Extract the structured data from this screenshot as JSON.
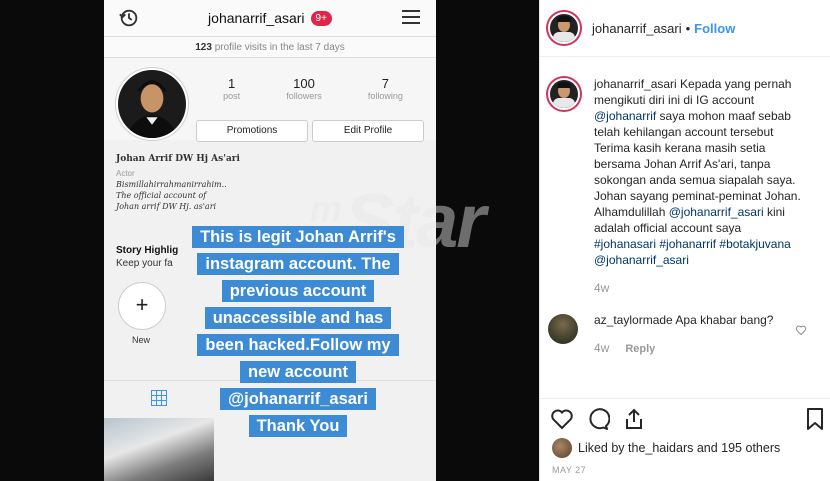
{
  "story": {
    "username": "johanarrif_asari",
    "notification_badge": "9+",
    "visits_count": "123",
    "visits_text": " profile visits in the last 7 days",
    "stats": [
      {
        "value": "1",
        "label": "post"
      },
      {
        "value": "100",
        "label": "followers"
      },
      {
        "value": "7",
        "label": "following"
      }
    ],
    "promotions_label": "Promotions",
    "edit_profile_label": "Edit Profile",
    "bio_name": "Johan Arrif DW Hj As'ari",
    "bio_category": "Actor",
    "bio_lines": [
      "Bismillahirrahmanirrahim..",
      "The official account of",
      "Johan arrif DW Hj. as'ari"
    ],
    "story_highlights_title": "Story Highlig",
    "story_highlights_sub": "Keep your fa",
    "new_label": "New",
    "caption_lines": [
      "This is legit Johan Arrif's",
      "instagram account. The",
      "previous account",
      "unaccessible and has",
      "been hacked.Follow my",
      "new account",
      "@johanarrif_asari",
      "Thank You"
    ]
  },
  "watermark": {
    "prefix": "m",
    "text": "Star"
  },
  "post": {
    "header_username": "johanarrif_asari",
    "follow_label": "Follow",
    "caption": {
      "username": "johanarrif_asari",
      "text_1": " Kepada yang pernah mengikuti diri ini di IG account ",
      "mention_1": "@johanarrif",
      "text_2": " saya mohon maaf sebab telah kehilangan account tersebut Terima kasih kerana masih setia bersama Johan Arrif As'ari, tanpa sokongan anda semua siapalah saya. Johan sayang peminat-peminat Johan. Alhamdulillah ",
      "mention_2": "@johanarrif_asari",
      "text_3": " kini adalah official account saya ",
      "hashtags": "#johanasari #johanarrif #botakjuvana",
      "mention_3": "@johanarrif_asari",
      "age": "4w"
    },
    "comment": {
      "username": "az_taylormade",
      "text": " Apa khabar bang?",
      "age": "4w",
      "reply_label": "Reply"
    },
    "likes_text": "Liked by the_haidars and 195 others",
    "date": "MAY 27"
  },
  "colors": {
    "accent": "#3897f0",
    "caption_bg": "#3d8bd5",
    "badge": "#e0254a"
  }
}
